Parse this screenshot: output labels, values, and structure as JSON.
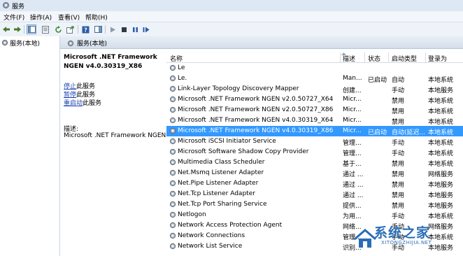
{
  "window": {
    "title": "服务"
  },
  "menu": [
    "文件(F)",
    "操作(A)",
    "查看(V)",
    "帮助(H)"
  ],
  "toolbar": {
    "icons": [
      "back-icon",
      "forward-icon",
      "console-tree-icon",
      "properties-icon",
      "refresh-icon",
      "export-icon",
      "help-icon",
      "show-hide-icon",
      "start-icon",
      "stop-icon",
      "pause-icon",
      "restart-icon"
    ]
  },
  "tree": {
    "root": "服务(本地)"
  },
  "header": {
    "title": "服务(本地)"
  },
  "description": {
    "service_name_line1": "Microsoft .NET Framework",
    "service_name_line2": "NGEN v4.0.30319_X86",
    "stop_link": "停止",
    "stop_suffix": "此服务",
    "pause_link": "暂停",
    "pause_suffix": "此服务",
    "restart_link": "重启动",
    "restart_suffix": "此服务",
    "desc_label": "描述:",
    "desc_text": "Microsoft .NET Framework NGEN"
  },
  "columns": {
    "name": "名称",
    "desc": "描述",
    "status": "状态",
    "startup": "启动类型",
    "logon": "登录为"
  },
  "rows": [
    {
      "name": "Le",
      "desc": "",
      "status": "",
      "startup": "",
      "logon": ""
    },
    {
      "name": "Le.",
      "desc": "Man...",
      "status": "已启动",
      "startup": "自动",
      "logon": "本地系统"
    },
    {
      "name": "Link-Layer Topology Discovery Mapper",
      "desc": "创建...",
      "status": "",
      "startup": "手动",
      "logon": "本地服务"
    },
    {
      "name": "Microsoft .NET Framework NGEN v2.0.50727_X64",
      "desc": "Micr...",
      "status": "",
      "startup": "禁用",
      "logon": "本地系统"
    },
    {
      "name": "Microsoft .NET Framework NGEN v2.0.50727_X86",
      "desc": "Micr...",
      "status": "",
      "startup": "禁用",
      "logon": "本地系统"
    },
    {
      "name": "Microsoft .NET Framework NGEN v4.0.30319_X64",
      "desc": "Micr...",
      "status": "",
      "startup": "禁用",
      "logon": "本地系统"
    },
    {
      "name": "Microsoft .NET Framework NGEN v4.0.30319_X86",
      "desc": "Micr...",
      "status": "已启动",
      "startup": "自动(延迟...",
      "logon": "本地系统"
    },
    {
      "name": "Microsoft iSCSI Initiator Service",
      "desc": "管理...",
      "status": "",
      "startup": "手动",
      "logon": "本地系统"
    },
    {
      "name": "Microsoft Software Shadow Copy Provider",
      "desc": "管理...",
      "status": "",
      "startup": "手动",
      "logon": "本地系统"
    },
    {
      "name": "Multimedia Class Scheduler",
      "desc": "基于...",
      "status": "",
      "startup": "禁用",
      "logon": "本地系统"
    },
    {
      "name": "Net.Msmq Listener Adapter",
      "desc": "通过 ...",
      "status": "",
      "startup": "禁用",
      "logon": "网络服务"
    },
    {
      "name": "Net.Pipe Listener Adapter",
      "desc": "通过 ...",
      "status": "",
      "startup": "禁用",
      "logon": "本地服务"
    },
    {
      "name": "Net.Tcp Listener Adapter",
      "desc": "通过 ...",
      "status": "",
      "startup": "禁用",
      "logon": "本地服务"
    },
    {
      "name": "Net.Tcp Port Sharing Service",
      "desc": "提供...",
      "status": "",
      "startup": "禁用",
      "logon": "本地服务"
    },
    {
      "name": "Netlogon",
      "desc": "为用...",
      "status": "",
      "startup": "手动",
      "logon": "本地系统"
    },
    {
      "name": "Network Access Protection Agent",
      "desc": "网络...",
      "status": "",
      "startup": "手动",
      "logon": "网络服务"
    },
    {
      "name": "Network Connections",
      "desc": "管理...",
      "status": "",
      "startup": "手动",
      "logon": "本地系统"
    },
    {
      "name": "Network List Service",
      "desc": "识别...",
      "status": "",
      "startup": "手动",
      "logon": "本地服务"
    }
  ],
  "selected_row": 6,
  "watermark": {
    "text": "系统之家",
    "sub": "XITONGZHIJIA.NET"
  },
  "colors": {
    "selection": "#3399ff",
    "link": "#1e45b4",
    "watermark": "#2a6db5"
  }
}
